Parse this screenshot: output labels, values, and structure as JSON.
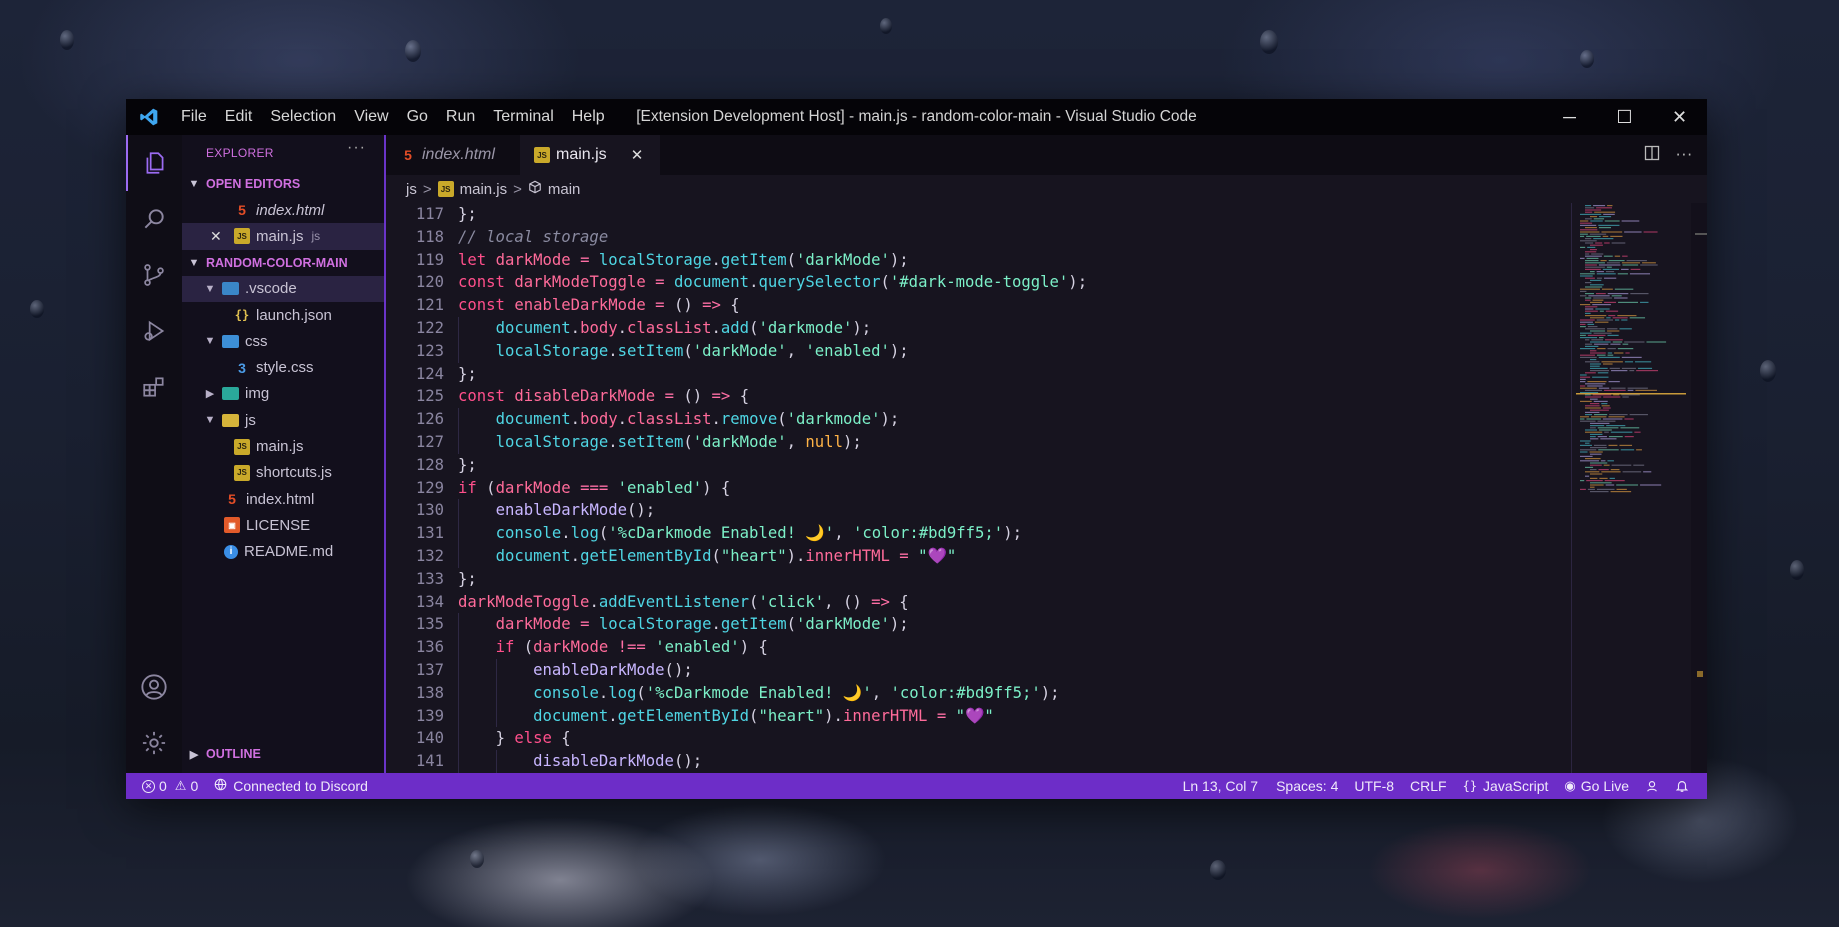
{
  "titlebar": {
    "menu": [
      "File",
      "Edit",
      "Selection",
      "View",
      "Go",
      "Run",
      "Terminal",
      "Help"
    ],
    "title": "[Extension Development Host] - main.js - random-color-main - Visual Studio Code",
    "minimize": "─",
    "maximize": "☐",
    "close": "✕"
  },
  "sidebar": {
    "header": "EXPLORER",
    "more": "···",
    "open_editors_label": "OPEN EDITORS",
    "open_editors": [
      {
        "name": "index.html",
        "type": "html"
      },
      {
        "name": "main.js",
        "type": "js",
        "suffix": "js"
      }
    ],
    "project_label": "RANDOM-COLOR-MAIN",
    "tree": {
      "vscode": ".vscode",
      "launch": "launch.json",
      "css": "css",
      "style": "style.css",
      "img": "img",
      "js": "js",
      "mainjs": "main.js",
      "shortcuts": "shortcuts.js",
      "index": "index.html",
      "license": "LICENSE",
      "readme": "README.md"
    },
    "outline_label": "OUTLINE"
  },
  "tabs": [
    {
      "label": "index.html",
      "type": "html",
      "active": false
    },
    {
      "label": "main.js",
      "type": "js",
      "active": true
    }
  ],
  "breadcrumb": {
    "folder": "js",
    "file": "main.js",
    "symbol": "main"
  },
  "code": {
    "lines": [
      {
        "n": "117",
        "text": "};"
      },
      {
        "n": "118",
        "text": "// local storage"
      },
      {
        "n": "119",
        "text": "let darkMode = localStorage.getItem('darkMode');"
      },
      {
        "n": "120",
        "text": "const darkModeToggle = document.querySelector('#dark-mode-toggle');"
      },
      {
        "n": "121",
        "text": "const enableDarkMode = () => {"
      },
      {
        "n": "122",
        "text": "    document.body.classList.add('darkmode');"
      },
      {
        "n": "123",
        "text": "    localStorage.setItem('darkMode', 'enabled');"
      },
      {
        "n": "124",
        "text": "};"
      },
      {
        "n": "125",
        "text": "const disableDarkMode = () => {"
      },
      {
        "n": "126",
        "text": "    document.body.classList.remove('darkmode');"
      },
      {
        "n": "127",
        "text": "    localStorage.setItem('darkMode', null);"
      },
      {
        "n": "128",
        "text": "};"
      },
      {
        "n": "129",
        "text": "if (darkMode === 'enabled') {"
      },
      {
        "n": "130",
        "text": "    enableDarkMode();"
      },
      {
        "n": "131",
        "text": "    console.log('%cDarkmode Enabled! 🌙', 'color:#bd9ff5;');"
      },
      {
        "n": "132",
        "text": "    document.getElementById(\"heart\").innerHTML = \"💜\""
      },
      {
        "n": "133",
        "text": "};"
      },
      {
        "n": "134",
        "text": "darkModeToggle.addEventListener('click', () => {"
      },
      {
        "n": "135",
        "text": "    darkMode = localStorage.getItem('darkMode');"
      },
      {
        "n": "136",
        "text": "    if (darkMode !== 'enabled') {"
      },
      {
        "n": "137",
        "text": "        enableDarkMode();"
      },
      {
        "n": "138",
        "text": "        console.log('%cDarkmode Enabled! 🌙', 'color:#bd9ff5;');"
      },
      {
        "n": "139",
        "text": "        document.getElementById(\"heart\").innerHTML = \"💜\""
      },
      {
        "n": "140",
        "text": "    } else {"
      },
      {
        "n": "141",
        "text": "        disableDarkMode();"
      }
    ]
  },
  "status": {
    "errors": "0",
    "warnings": "0",
    "discord": "Connected to Discord",
    "position": "Ln 13, Col 7",
    "spaces": "Spaces: 4",
    "encoding": "UTF-8",
    "eol": "CRLF",
    "language": "JavaScript",
    "golive": "Go Live"
  },
  "colors": {
    "accent": "#6d2dc8",
    "sidebar_header": "#d070e0",
    "keyword": "#ff4f8b",
    "string": "#7cf0c8",
    "property": "#4fd6e4"
  }
}
